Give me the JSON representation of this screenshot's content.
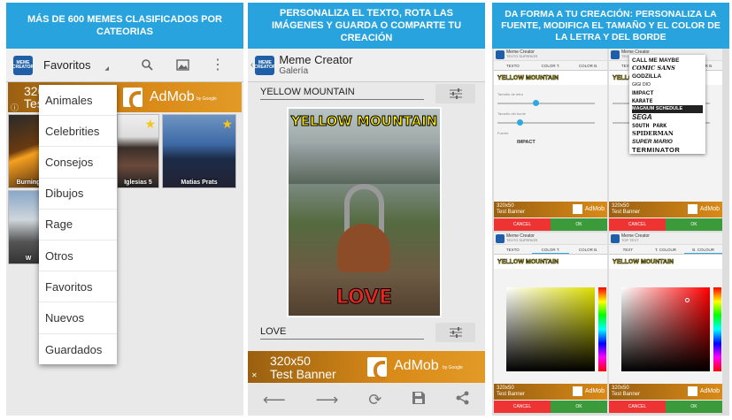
{
  "panel1": {
    "banner": "MÁS DE 600 MEMES CLASIFICADOS POR CATEORIAS",
    "app_icon_text": "MEME CREATOR",
    "toolbar_title": "Favoritos",
    "ad_text_line1": "320",
    "ad_text_line2": "Tes",
    "admob_label": "AdMob",
    "admob_sub": "by Google",
    "grid_captions": [
      "Burning",
      "Iglesias 5",
      "Matias Prats",
      "W"
    ],
    "menu_items": [
      "Animales",
      "Celebrities",
      "Consejos",
      "Dibujos",
      "Rage",
      "Otros",
      "Favoritos",
      "Nuevos",
      "Guardados"
    ]
  },
  "panel2": {
    "banner": "PERSONALIZA EL TEXTO, ROTA LAS IMÁGENES Y GUARDA O COMPARTE TU CREACIÓN",
    "app_title": "Meme Creator",
    "app_subtitle": "Galería",
    "top_text_value": "YELLOW MOUNTAIN",
    "bottom_text_value": "LOVE",
    "meme_top": "YELLOW MOUNTAIN",
    "meme_bottom": "LOVE",
    "ad_line1": "320x50",
    "ad_line2": "Test Banner",
    "admob_label": "AdMob",
    "admob_sub": "by Google"
  },
  "panel3": {
    "banner": "DA FORMA A TU CREACIÓN: PERSONALIZA LA FUENTE, MODIFICA EL TAMAÑO Y EL COLOR DE LA LETRA Y DEL BORDE",
    "app_title": "Meme Creator",
    "sub_texto_superior": "TEXTO SUPERIOR",
    "sub_top_text": "TOP TEXT",
    "tabs_es": [
      "TEXTO",
      "COLOR T.",
      "COLOR B."
    ],
    "tabs_es_b": [
      "TEXTO",
      "COLOR T.",
      "COLOR B."
    ],
    "tabs_en": [
      "TEXT",
      "T. COLOUR",
      "B. COLOUR"
    ],
    "strip_text": "YELLOW MOUNTAIN",
    "label_size": "Tamaño de letra",
    "label_border": "Tamaño del borde",
    "label_font": "Fuente",
    "font_value": "IMPACT",
    "fonts": [
      "CALL ME MAYBE",
      "COMIC SANS",
      "GODZILLA",
      "GIGI DIO",
      "IMPACT",
      "KARATE",
      "MAGNUM SCHEDULE",
      "SEGA",
      "SOUTH PARK",
      "SPIDERMAN",
      "SUPER MARIO",
      "TERMINATOR"
    ],
    "ad_line1": "320x50",
    "ad_line2": "Test Banner",
    "admob_label": "AdMob",
    "cancel_es": "CANCEL",
    "ok": "OK",
    "cancel_en": "CANCEL"
  },
  "colors": {
    "banner": "#29a3de",
    "cancel": "#ee3333",
    "ok": "#3b9b3b",
    "meme_yellow": "#ffeb00",
    "meme_red": "#e8261e"
  }
}
